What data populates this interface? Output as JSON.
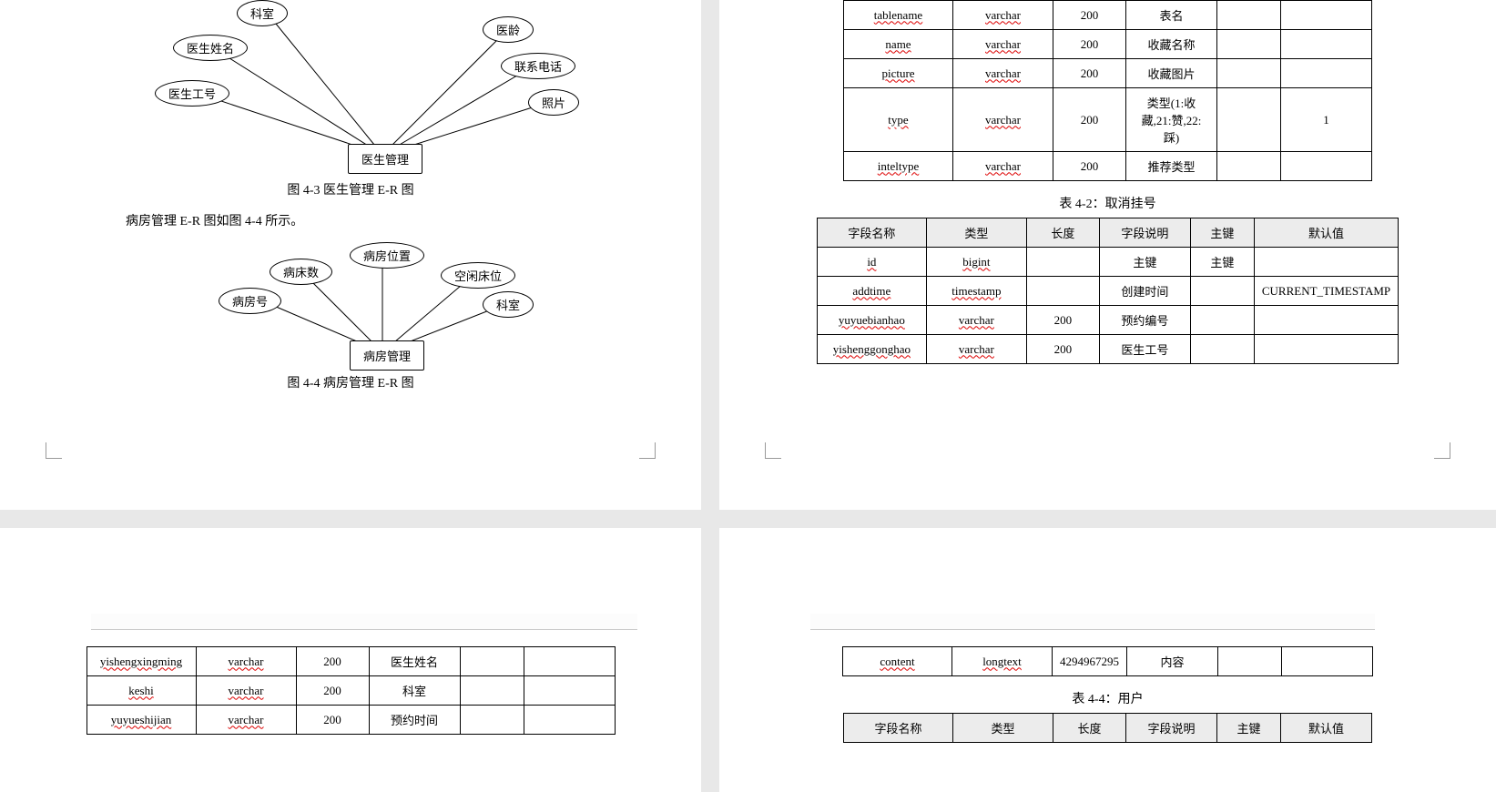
{
  "er1": {
    "entity": "医生管理",
    "attrs": [
      "科室",
      "医生姓名",
      "医生工号",
      "医龄",
      "联系电话",
      "照片"
    ],
    "caption": "图 4-3 医生管理 E-R 图"
  },
  "leadText": "病房管理 E-R 图如图 4-4 所示。",
  "er2": {
    "entity": "病房管理",
    "attrs": [
      "病床数",
      "病房号",
      "病房位置",
      "空闲床位",
      "科室"
    ],
    "caption": "图 4-4 病房管理 E-R 图"
  },
  "table_headers": [
    "字段名称",
    "类型",
    "长度",
    "字段说明",
    "主键",
    "默认值"
  ],
  "table1_rows": [
    {
      "f": "tablename",
      "t": "varchar",
      "l": "200",
      "d": "表名",
      "k": "",
      "v": ""
    },
    {
      "f": "name",
      "t": "varchar",
      "l": "200",
      "d": "收藏名称",
      "k": "",
      "v": ""
    },
    {
      "f": "picture",
      "t": "varchar",
      "l": "200",
      "d": "收藏图片",
      "k": "",
      "v": ""
    },
    {
      "f": "type",
      "t": "varchar",
      "l": "200",
      "d": "类型(1:收藏,21:赞,22:踩)",
      "k": "",
      "v": "1"
    },
    {
      "f": "inteltype",
      "t": "varchar",
      "l": "200",
      "d": "推荐类型",
      "k": "",
      "v": ""
    }
  ],
  "table2_caption": "表 4-2：取消挂号",
  "table2_rows": [
    {
      "f": "id",
      "t": "bigint",
      "l": "",
      "d": "主键",
      "k": "主键",
      "v": ""
    },
    {
      "f": "addtime",
      "t": "timestamp",
      "l": "",
      "d": "创建时间",
      "k": "",
      "v": "CURRENT_TIMESTAMP"
    },
    {
      "f": "yuyuebianhao",
      "t": "varchar",
      "l": "200",
      "d": "预约编号",
      "k": "",
      "v": ""
    },
    {
      "f": "yishenggonghao",
      "t": "varchar",
      "l": "200",
      "d": "医生工号",
      "k": "",
      "v": ""
    }
  ],
  "table3_rows": [
    {
      "f": "yishengxingming",
      "t": "varchar",
      "l": "200",
      "d": "医生姓名",
      "k": "",
      "v": ""
    },
    {
      "f": "keshi",
      "t": "varchar",
      "l": "200",
      "d": "科室",
      "k": "",
      "v": ""
    },
    {
      "f": "yuyueshijian",
      "t": "varchar",
      "l": "200",
      "d": "预约时间",
      "k": "",
      "v": ""
    }
  ],
  "table4_rows": [
    {
      "f": "content",
      "t": "longtext",
      "l": "4294967295",
      "d": "内容",
      "k": "",
      "v": ""
    }
  ],
  "table5_caption": "表 4-4：用户",
  "col_widths": {
    "f": 120,
    "t": 110,
    "l": 80,
    "d": 100,
    "k": 70,
    "v": 100
  }
}
